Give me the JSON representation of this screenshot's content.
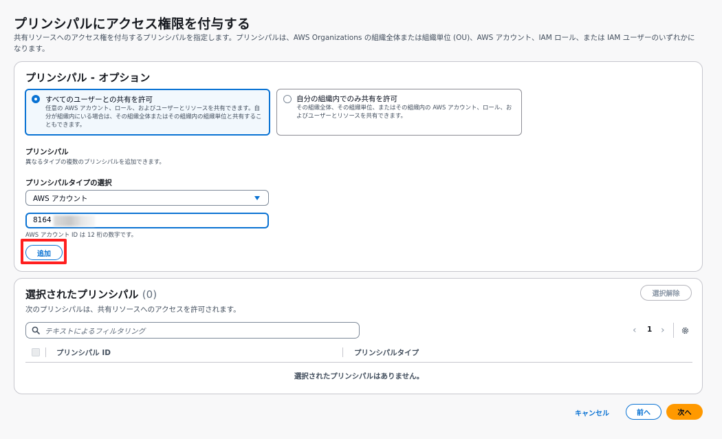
{
  "page": {
    "title": "プリンシパルにアクセス権限を付与する",
    "description": "共有リソースへのアクセス権を付与するプリンシパルを指定します。プリンシパルは、AWS Organizations の組織全体または組織単位 (OU)、AWS アカウント、IAM ロール、または IAM ユーザーのいずれかになります。"
  },
  "options": {
    "title": "プリンシパル - オプション",
    "tiles": [
      {
        "label": "すべてのユーザーとの共有を許可",
        "description": "任意の AWS アカウント、ロール、およびユーザーとリソースを共有できます。自分が組織内にいる場合は、その組織全体またはその組織内の組織単位と共有することもできます。",
        "selected": true
      },
      {
        "label": "自分の組織内でのみ共有を許可",
        "description": "その組織全体、その組織単位、またはその組織内の AWS アカウント、ロール、およびユーザーとリソースを共有できます。",
        "selected": false
      }
    ],
    "principal_label": "プリンシパル",
    "principal_desc": "異なるタイプの複数のプリンシパルを追加できます。",
    "type_label": "プリンシパルタイプの選択",
    "type_value": "AWS アカウント",
    "id_value": "8164",
    "id_hint": "AWS アカウント ID は 12 桁の数字です。",
    "add_label": "追加"
  },
  "selected": {
    "title": "選択されたプリンシパル",
    "count": "(0)",
    "description": "次のプリンシパルは、共有リソースへのアクセスを許可されます。",
    "clear_label": "選択解除",
    "filter_placeholder": "テキストによるフィルタリング",
    "page": "1",
    "columns": [
      "プリンシパル ID",
      "プリンシパルタイプ"
    ],
    "empty": "選択されたプリンシパルはありません。"
  },
  "footer": {
    "cancel": "キャンセル",
    "prev": "前へ",
    "next": "次へ"
  },
  "colors": {
    "accent": "#0972d3",
    "primary": "#ff9900",
    "highlight": "#ff1f1f"
  }
}
